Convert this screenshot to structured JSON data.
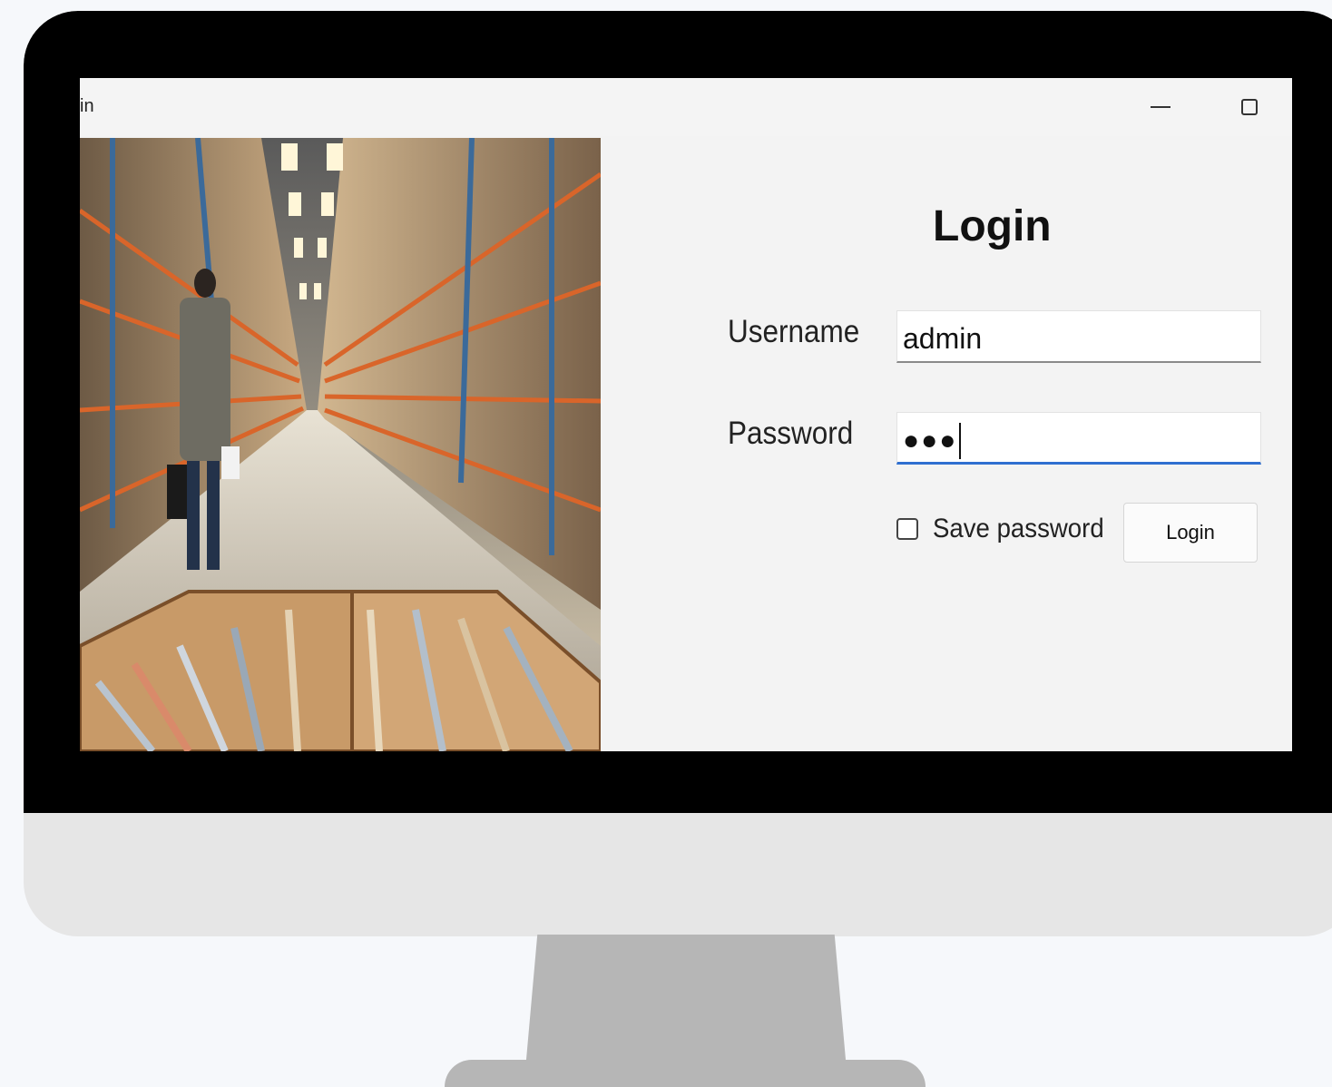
{
  "window": {
    "title": "in",
    "controls": {
      "minimize_icon": "minimize-icon",
      "maximize_icon": "maximize-icon"
    }
  },
  "photo": {
    "subject": "warehouse-aisle-image"
  },
  "form": {
    "title": "Login",
    "username_label": "Username",
    "username_value": "admin",
    "password_label": "Password",
    "password_masked": "●●●",
    "save_password_label": "Save password",
    "save_password_checked": false,
    "login_button_label": "Login"
  },
  "colors": {
    "focus_underline": "#2f6fd0",
    "bezel": "#000000",
    "window_bg": "#f3f3f3"
  }
}
